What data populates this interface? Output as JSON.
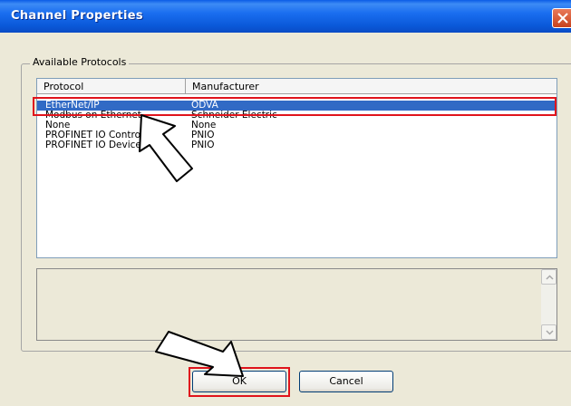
{
  "window": {
    "title": "Channel Properties"
  },
  "group": {
    "label": "Available Protocols"
  },
  "list": {
    "columns": [
      "Protocol",
      "Manufacturer"
    ],
    "rows": [
      {
        "protocol": "EtherNet/IP",
        "manufacturer": "ODVA"
      },
      {
        "protocol": "Modbus on Ethernet",
        "manufacturer": "Schneider Electric"
      },
      {
        "protocol": "None",
        "manufacturer": "None"
      },
      {
        "protocol": "PROFINET IO Controller",
        "manufacturer": "PNIO"
      },
      {
        "protocol": "PROFINET IO Device",
        "manufacturer": "PNIO"
      }
    ],
    "selected_index": 0
  },
  "buttons": {
    "ok": "OK",
    "cancel": "Cancel"
  },
  "colors": {
    "title_bar": "#0a5ce6",
    "selection": "#316ac5",
    "highlight": "#e0141c",
    "dialog_bg": "#ece9d8"
  }
}
